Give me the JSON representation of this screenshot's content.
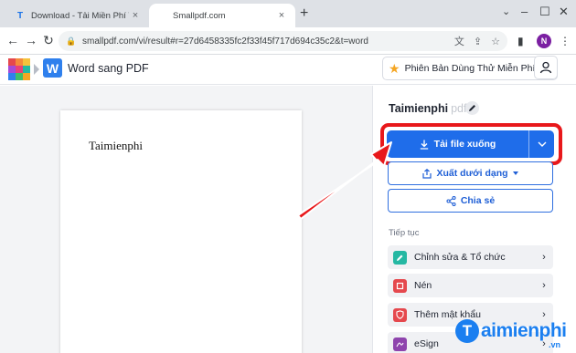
{
  "browser": {
    "tabs": [
      {
        "title": "Download - Tải Miền Phí VN - Ph",
        "close": "×"
      },
      {
        "title": "Smallpdf.com",
        "close": "×"
      }
    ],
    "new_tab": "+",
    "address": "smallpdf.com/vi/result#r=27d6458335fc2f33f45f717d694c35c2&t=word",
    "avatar_letter": "N"
  },
  "header": {
    "tool_name": "Word sang PDF",
    "tool_icon_letter": "W",
    "pro_label": "Phiên Bản Dùng Thử Miễn Phí"
  },
  "preview": {
    "document_text": "Taimienphi"
  },
  "panel": {
    "file_name": "Taimienphi",
    "file_ext": "pdf",
    "download_label": "Tải file xuống",
    "export_label": "Xuất dưới dạng",
    "share_label": "Chia sẻ",
    "continue_label": "Tiếp tục",
    "actions": [
      {
        "label": "Chỉnh sửa & Tổ chức",
        "icon": "edit-organize-icon",
        "color": "#25b8a3"
      },
      {
        "label": "Nén",
        "icon": "compress-icon",
        "color": "#e5484d"
      },
      {
        "label": "Thêm mật khẩu",
        "icon": "shield-lock-icon",
        "color": "#e5484d"
      },
      {
        "label": "eSign",
        "icon": "esign-icon",
        "color": "#8e44ad"
      }
    ]
  },
  "watermark": {
    "letter": "T",
    "text": "aimienphi",
    "suffix": ".vn"
  },
  "colors": {
    "accent": "#1f6dea",
    "highlight": "#e8181b",
    "tool_icon": "#2f80ed"
  }
}
